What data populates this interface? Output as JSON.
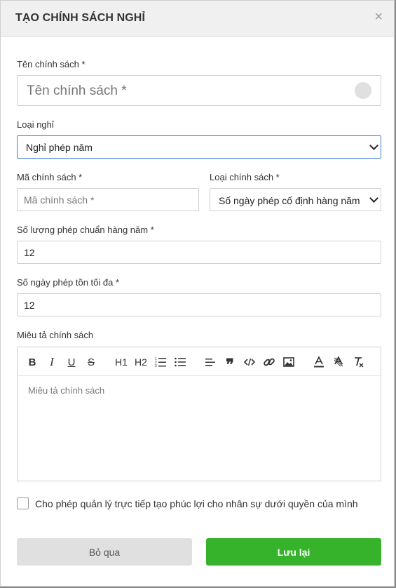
{
  "modal": {
    "title": "TẠO CHÍNH SÁCH NGHỈ",
    "close": "×"
  },
  "fields": {
    "policy_name": {
      "label": "Tên chính sách *",
      "placeholder": "Tên chính sách *"
    },
    "leave_type": {
      "label": "Loại nghỉ",
      "value": "Nghỉ phép năm"
    },
    "policy_code": {
      "label": "Mã chính sách *",
      "placeholder": "Mã chính sách *"
    },
    "policy_type": {
      "label": "Loại chính sách *",
      "value": "Số ngày phép cố định hàng năm"
    },
    "standard_leave": {
      "label": "Số lượng phép chuẩn hàng năm *",
      "value": "12"
    },
    "max_leave": {
      "label": "Số ngày phép tồn tối đa *",
      "value": "12"
    },
    "description": {
      "label": "Miêu tả chính sách",
      "placeholder": "Miêu tả chính sách"
    }
  },
  "toolbar": {
    "bold": "B",
    "italic": "I",
    "underline": "U",
    "strike": "S",
    "h1": "H1",
    "h2": "H2",
    "quote": "❞"
  },
  "checkbox": {
    "label": "Cho phép quản lý trực tiếp tạo phúc lợi cho nhân sự dưới quyền của mình",
    "checked": false
  },
  "buttons": {
    "skip": "Bỏ qua",
    "save": "Lưu lại"
  },
  "colors": {
    "save_button": "#36b22b",
    "focus_border": "#3b7fd6",
    "header_bg": "#f0f0f0"
  }
}
